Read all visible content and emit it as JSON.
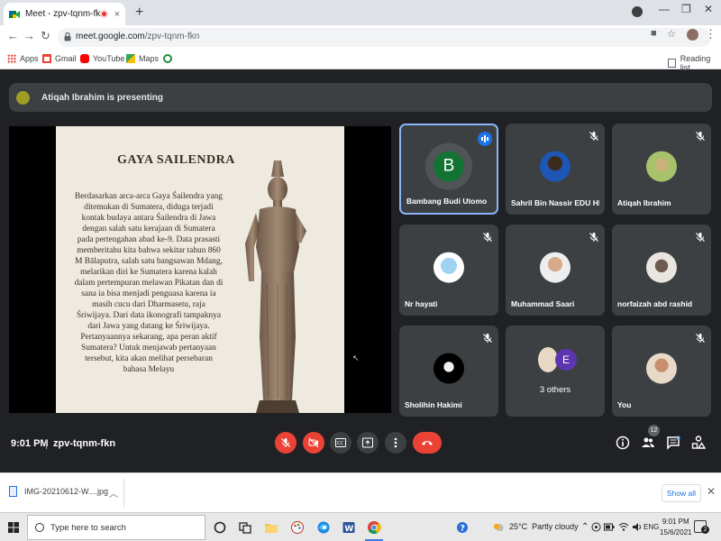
{
  "browser": {
    "tab_title": "Meet - zpv-tqnm-fkn",
    "tab_close": "×",
    "new_tab": "+",
    "url_host": "meet.google.com",
    "url_path": "/zpv-tqnm-fkn",
    "bookmarks": [
      {
        "label": "Apps"
      },
      {
        "label": "Gmail"
      },
      {
        "label": "YouTube"
      },
      {
        "label": "Maps"
      }
    ],
    "reading_list": "Reading list"
  },
  "meet": {
    "presenting": "Atiqah Ibrahim is presenting",
    "slide": {
      "title": "GAYA SAILENDRA",
      "body": "Berdasarkan arca-arca Gaya Śailendra yang ditemukan di Sumatera, diduga terjadi kontak budaya antara Śailendra di Jawa dengan salah satu kerajaan di Sumatera pada pertengahan abad ke-9. Data prasasti memberitahu kita bahwa sekitar tahun 860 M Bālaputra, salah satu bangsawan Mdang, melarikan diri ke Sumatera karena kalah dalam pertempuran melawan Pikatan dan di sana ia bisa menjadi penguasa karena ia masih cucu dari Dharmasetu, raja Śriwijaya. Dari data ikonografi tampaknya dari Jawa yang datang ke Śriwijaya. Pertanyaannya sekarang, apa peran aktif Sumatera? Untuk menjawab pertanyaan tersebut, kita akan melihat persebaran bahasa Melayu"
    },
    "participants": [
      {
        "name": "Bambang Budi Utomo",
        "initial": "B"
      },
      {
        "name": "Sahril Bin Nassir EDU HI..."
      },
      {
        "name": "Atiqah Ibrahim"
      },
      {
        "name": "Nr hayati"
      },
      {
        "name": "Muhammad Saari"
      },
      {
        "name": "norfaizah abd rashid"
      },
      {
        "name": "Sholihin Hakimi"
      },
      {
        "name": "3 others",
        "initial": "E"
      },
      {
        "name": "You"
      }
    ],
    "time": "9:01 PM",
    "meeting_code": "zpv-tqnm-fkn",
    "people_count": "12",
    "colors": {
      "accent": "#8ab4f8",
      "danger": "#ea4335",
      "tile": "#3c4043",
      "bg": "#202124"
    }
  },
  "downloads": {
    "file": "IMG-20210612-W....jpg",
    "show_all": "Show all"
  },
  "taskbar": {
    "search_placeholder": "Type here to search",
    "weather_temp": "25°C",
    "weather_desc": "Partly cloudy",
    "lang": "ENG",
    "clock_time": "9:01 PM",
    "clock_date": "15/6/2021",
    "notification_count": "2"
  }
}
